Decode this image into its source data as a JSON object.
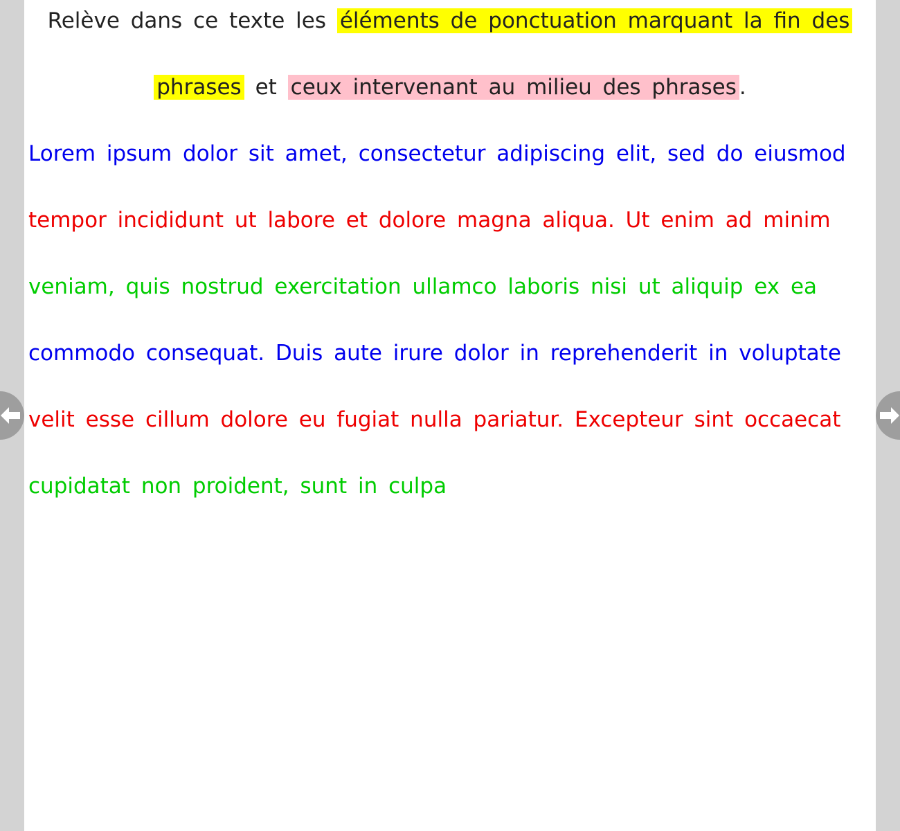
{
  "instruction": {
    "part1": "Relève dans ce texte les",
    "highlight_end": "éléments de ponctuation marquant la fin des",
    "highlight_end_cont": "phrases",
    "connector": "et",
    "highlight_middle": "ceux intervenant au milieu des phrases",
    "final_dot": "."
  },
  "text_lines": [
    {
      "text": "Lorem ipsum dolor sit amet, consectetur adipiscing elit, sed do eiusmod",
      "color": "#0000ee"
    },
    {
      "text": "tempor incididunt ut labore et dolore magna aliqua. Ut enim ad minim",
      "color": "#ee0000"
    },
    {
      "text": "veniam, quis nostrud exercitation ullamco laboris nisi ut aliquip ex ea",
      "color": "#00cc00"
    },
    {
      "text": "commodo consequat. Duis aute irure dolor in reprehenderit in voluptate",
      "color": "#0000ee"
    },
    {
      "text": "velit esse cillum dolore eu fugiat nulla pariatur. Excepteur sint occaecat",
      "color": "#ee0000"
    },
    {
      "text": "cupidatat non proident, sunt in culpa",
      "color": "#00cc00"
    }
  ],
  "colors": {
    "highlight_end": "#ffff00",
    "highlight_middle": "#ffc0cb",
    "nav_button": "#9e9e9e"
  },
  "nav": {
    "prev_icon": "arrow-left-icon",
    "next_icon": "arrow-right-icon"
  }
}
